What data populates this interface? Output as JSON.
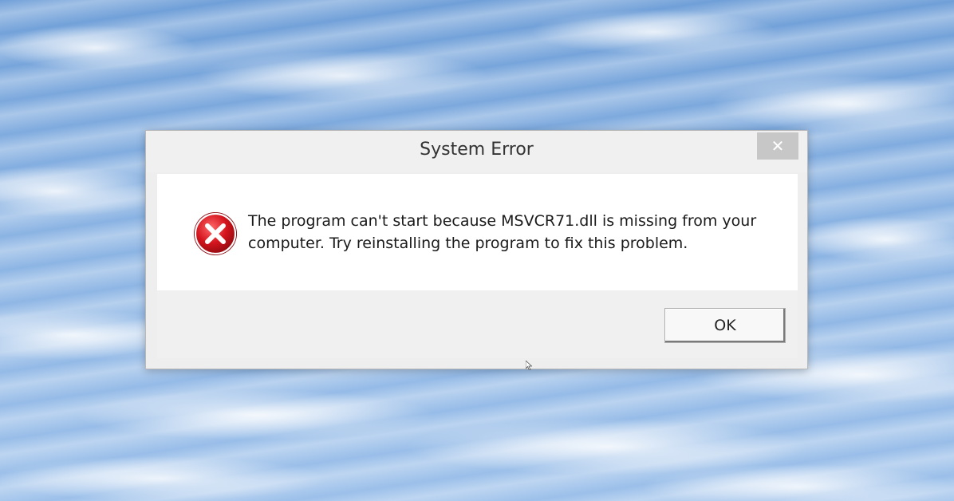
{
  "dialog": {
    "title": "System Error",
    "close_icon": "close-icon",
    "close_glyph": "✕",
    "error_icon": "error-icon",
    "message": "The program can't start because MSVCR71.dll is missing from your computer. Try reinstalling the program to fix this problem.",
    "ok_label": "OK"
  },
  "colors": {
    "error_red": "#c8121c",
    "close_button": "#c7c7c7",
    "sky_blue": "#7aa8dd"
  }
}
